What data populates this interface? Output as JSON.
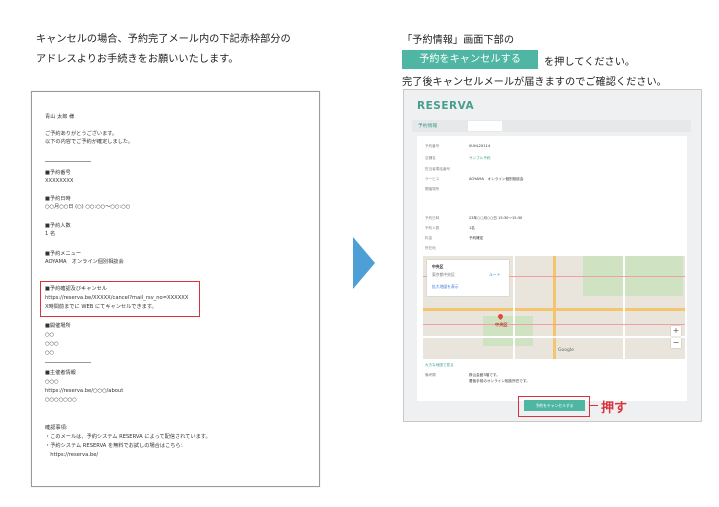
{
  "intro": {
    "line1": "キャンセルの場合、予約完了メール内の下記赤枠部分の",
    "line2": "アドレスよりお手続きをお願いいたします。"
  },
  "instructions": {
    "line1": "「予約情報」画面下部の",
    "cancel_pill": "予約をキャンセルする",
    "after_pill": "を押してください。",
    "line3": "完了後キャンセルメールが届きますのでご確認ください。"
  },
  "email": {
    "greeting": "青山 太郎 様",
    "thanks": "ご予約ありがとうございます。",
    "confirmed": "以下の内容でご予約が確定しました。",
    "number_label": "■予約番号",
    "number_value": "XXXXXXXX",
    "datetime_label": "■予約日時",
    "datetime_value": "○○月○○日 (○) ○○:○○〜○○:○○",
    "people_label": "■予約人数",
    "people_value": "1 名",
    "menu_label": "■予約メニュー",
    "menu_value": "AOYAMA　オンライン個別相談会",
    "cancel_label": "■予約確認及びキャンセル",
    "cancel_url": "https://reserva.be/XXXXX/cancel?mail_rsv_no=XXXXXX",
    "cancel_deadline": "X時間前までに WEB にてキャンセルできます。",
    "venue_label": "■開催場所",
    "venue_1": "○○",
    "venue_2": "○○○",
    "venue_3": "○○",
    "org_label": "■主催者情報",
    "org_1": "○○○",
    "org_url": "https://reserva.be/○○○/about",
    "org_3": "○○○○○○○",
    "notes_label": "確認事項:",
    "note_1": "・このメールは、予約システム RESERVA によって配信されています。",
    "note_2": "・予約システム RESERVA を無料でお試しの場合はこちら：",
    "note_3": "　https://reserva.be/"
  },
  "app": {
    "logo": "RESERVA",
    "tab_label": "予約情報",
    "rows": [
      {
        "label": "予約番号",
        "value": "0UHL2X114"
      },
      {
        "label": "店舗名",
        "value": "サンプル予約"
      },
      {
        "label": "担当者電話番号",
        "value": ""
      },
      {
        "label": "サービス",
        "value": "AOYAMA　オンライン個別相談会"
      },
      {
        "label": "開催場所",
        "value": ""
      },
      {
        "label": "予約日時",
        "value": "23年○○月○○日 15:30〜15:30"
      },
      {
        "label": "予約人数",
        "value": "1名"
      },
      {
        "label": "料金",
        "value": "予約確定"
      },
      {
        "label": "所在地",
        "value": ""
      }
    ],
    "map": {
      "place_name": "中央区",
      "place_sub": "東京都中央区",
      "directions": "ルート",
      "larger_map": "拡大地図を表示",
      "marker_label": "中央区",
      "zoom_in": "+",
      "zoom_out": "−",
      "google": "Google"
    },
    "map_link": "大きな地図で見る",
    "remarks_label": "備考欄",
    "remarks_1": "株山会館3階です。",
    "remarks_2": "看板手前のオンライン相談所在です。",
    "cancel_button": "予約をキャンセルする"
  },
  "press_label": "押す",
  "colors": {
    "accent": "#4fb6a3",
    "highlight": "#d8333b",
    "arrow": "#4d9fd6"
  }
}
